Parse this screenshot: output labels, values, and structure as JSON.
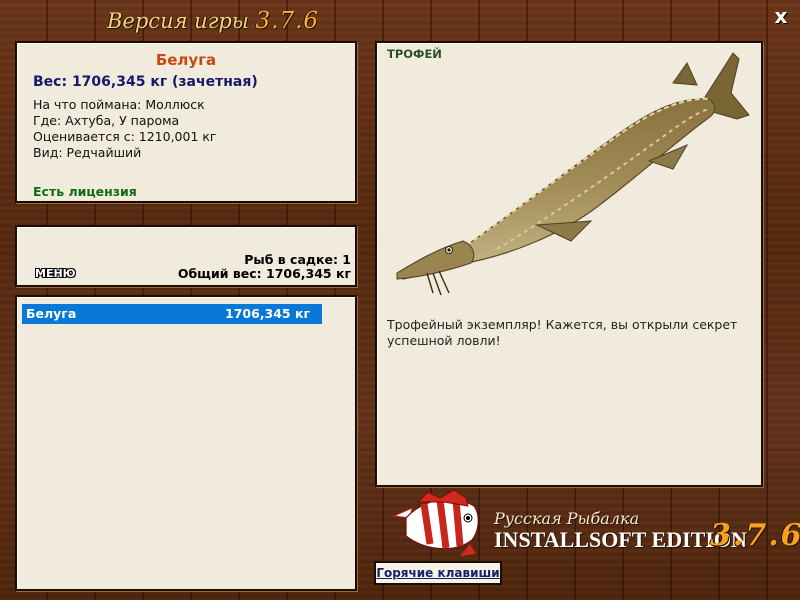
{
  "window": {
    "title_prefix": "Версия игры",
    "title_version": "3.7.6",
    "close_label": "x"
  },
  "catch": {
    "name": "Белуга",
    "weight_line": "Вес: 1706,345 кг (зачетная)",
    "bait_line": "На что поймана: Моллюск",
    "place_line": "Где: Ахтуба, У парома",
    "value_line": "Оценивается с: 1210,001 кг",
    "kind_line": "Вид: Редчайший",
    "license": "Есть лицензия"
  },
  "cage": {
    "menu_label": "МЕНЮ",
    "count_line": "Рыб в садке: 1",
    "total_line": "Общий вес: 1706,345 кг",
    "items": [
      {
        "name": "Белуга",
        "weight": "1706,345 кг"
      }
    ]
  },
  "preview": {
    "trophy_label": "ТРОФЕЙ",
    "description": "Трофейный экземпляр! Кажется, вы открыли секрет успешной ловли!"
  },
  "branding": {
    "line1": "Русская Рыбалка",
    "line2": "INSTALLSOFT EDITION",
    "version": "3.7.6"
  },
  "footer": {
    "hotkeys_label": "Горячие клавиши"
  },
  "colors": {
    "wood": "#5a2d14",
    "panel": "#f0ebdc",
    "selection": "#0a78d7",
    "fish_name": "#c44a12",
    "weight": "#15196b",
    "license": "#0f6b12",
    "title_gold": "#f2d782",
    "version_orange": "#f6a21e"
  }
}
